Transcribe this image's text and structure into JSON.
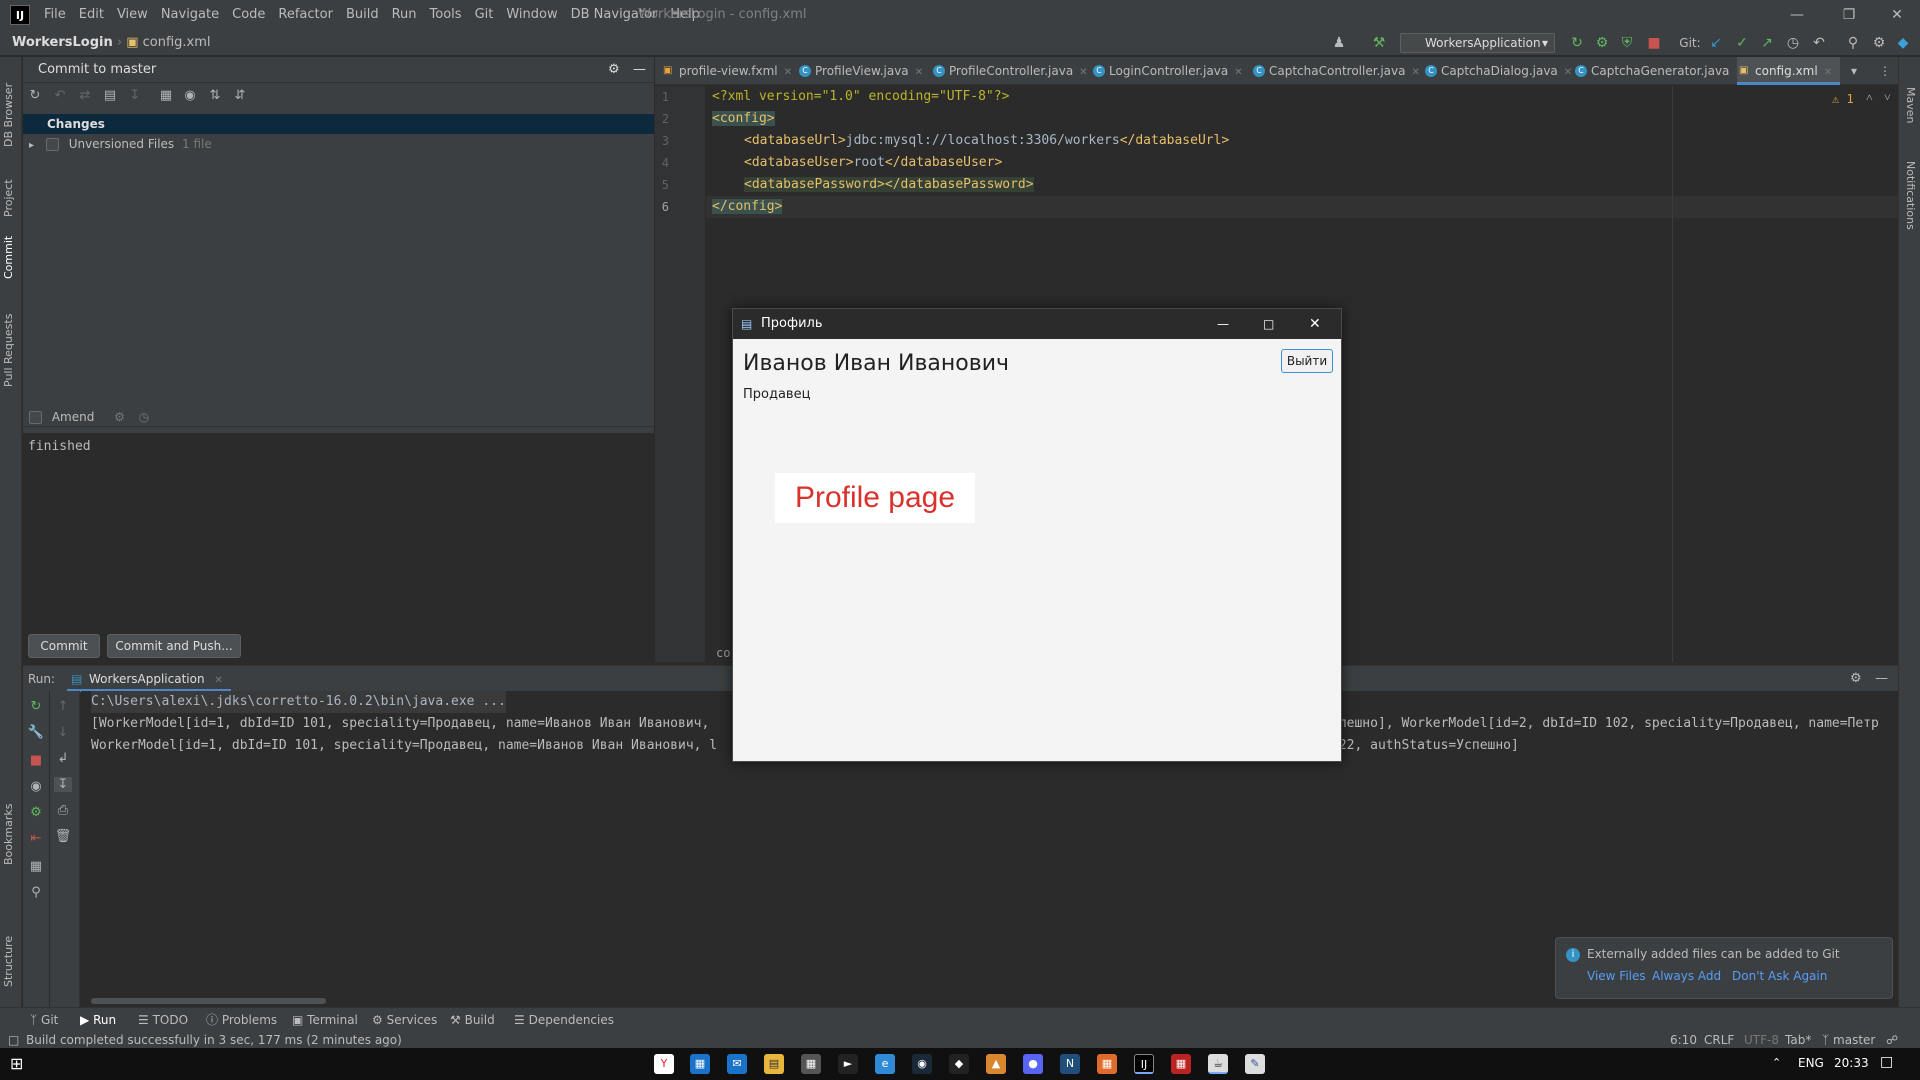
{
  "app": {
    "logo": "IJ",
    "menu": [
      "File",
      "Edit",
      "View",
      "Navigate",
      "Code",
      "Refactor",
      "Build",
      "Run",
      "Tools",
      "Git",
      "Window",
      "DB Navigator",
      "Help"
    ],
    "window_title": "WorkersLogin - config.xml",
    "breadcrumb": {
      "project": "WorkersLogin",
      "file": "config.xml"
    },
    "run_config": "WorkersApplication",
    "git_label": "Git:"
  },
  "left_stripe": [
    "DB Browser",
    "Project",
    "Commit",
    "Pull Requests",
    "Bookmarks",
    "Structure"
  ],
  "right_stripe": [
    "Maven",
    "Notifications"
  ],
  "commit_panel": {
    "title": "Commit to master",
    "changes_label": "Changes",
    "unversioned_label": "Unversioned Files",
    "unversioned_count": "1 file",
    "amend_label": "Amend",
    "message": "finished",
    "commit_button": "Commit",
    "commit_push_button": "Commit and Push..."
  },
  "editor": {
    "tabs": [
      {
        "label": "profile-view.fxml",
        "kind": "fxml"
      },
      {
        "label": "ProfileView.java",
        "kind": "class"
      },
      {
        "label": "ProfileController.java",
        "kind": "class"
      },
      {
        "label": "LoginController.java",
        "kind": "class"
      },
      {
        "label": "CaptchaController.java",
        "kind": "class"
      },
      {
        "label": "CaptchaDialog.java",
        "kind": "class"
      },
      {
        "label": "CaptchaGenerator.java",
        "kind": "class"
      },
      {
        "label": "config.xml",
        "kind": "xml"
      }
    ],
    "warning_count": "1",
    "line_numbers": [
      "1",
      "2",
      "3",
      "4",
      "5",
      "6"
    ],
    "code": {
      "l1_decl": "<?xml version=\"1.0\" encoding=\"UTF-8\"?>",
      "l2_open": "<config>",
      "l3_open": "<databaseUrl>",
      "l3_text": "jdbc:mysql://localhost:3306/workers",
      "l3_close": "</databaseUrl>",
      "l4_open": "<databaseUser>",
      "l4_text": "root",
      "l4_close": "</databaseUser>",
      "l5": "<databasePassword></databasePassword>",
      "l6": "</config>"
    },
    "breadcrumb_fragment": "co"
  },
  "run_panel": {
    "label": "Run:",
    "tab": "WorkersApplication",
    "console": {
      "cmd": "C:\\Users\\alexi\\.jdks\\corretto-16.0.2\\bin\\java.exe ...",
      "line2_left": "[WorkerModel[id=1, dbId=ID 101, speciality=Продавец, name=Иванов Иван Иванович,",
      "line2_right": "спешно], WorkerModel[id=2, dbId=ID 102, speciality=Продавец, name=Петр",
      "line3_left": "WorkerModel[id=1, dbId=ID 101, speciality=Продавец, name=Иванов Иван Иванович, l",
      "line3_right": "022, authStatus=Успешно]"
    }
  },
  "dialog": {
    "title": "Профиль",
    "name": "Иванов Иван Иванович",
    "role": "Продавец",
    "logout_button": "Выйти",
    "heading": "Profile page"
  },
  "bottom_tabs": [
    "Git",
    "Run",
    "TODO",
    "Problems",
    "Terminal",
    "Services",
    "Build",
    "Dependencies"
  ],
  "status": {
    "message": "Build completed successfully in 3 sec, 177 ms (2 minutes ago)",
    "position": "6:10",
    "line_sep": "CRLF",
    "encoding": "UTF-8",
    "indent": "Tab*",
    "branch": "master"
  },
  "notification": {
    "text": "Externally added files can be added to Git",
    "view_files": "View Files",
    "always_add": "Always Add",
    "dont_ask": "Don't Ask Again"
  },
  "taskbar": {
    "lang": "ENG",
    "time": "20:33"
  },
  "colors": {
    "accent": "#4a88c7",
    "profile_heading": "#d9312b",
    "link": "#589df6"
  }
}
